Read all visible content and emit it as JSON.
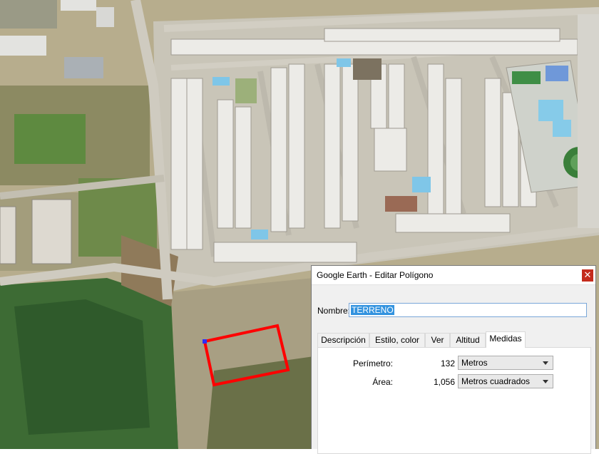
{
  "map": {
    "colors": {
      "dirt": "#b3a98b",
      "road": "#c8c4b8",
      "forest": "#3c6b35",
      "roof": "#e9e9e6",
      "polygon": "#ff0000",
      "pool": "#7fc6e8"
    }
  },
  "dialog": {
    "title": "Google Earth - Editar Polígono",
    "close_icon": "close-icon",
    "name_label": "Nombre:",
    "name_value": "TERRENO",
    "tabs": [
      {
        "label": "Descripción"
      },
      {
        "label": "Estilo, color"
      },
      {
        "label": "Ver"
      },
      {
        "label": "Altitud"
      },
      {
        "label": "Medidas",
        "active": true
      }
    ],
    "measurements": {
      "perimeter_label": "Perímetro:",
      "perimeter_value": "132",
      "perimeter_unit": "Metros",
      "area_label": "Área:",
      "area_value": "1,056",
      "area_unit": "Metros cuadrados"
    }
  }
}
